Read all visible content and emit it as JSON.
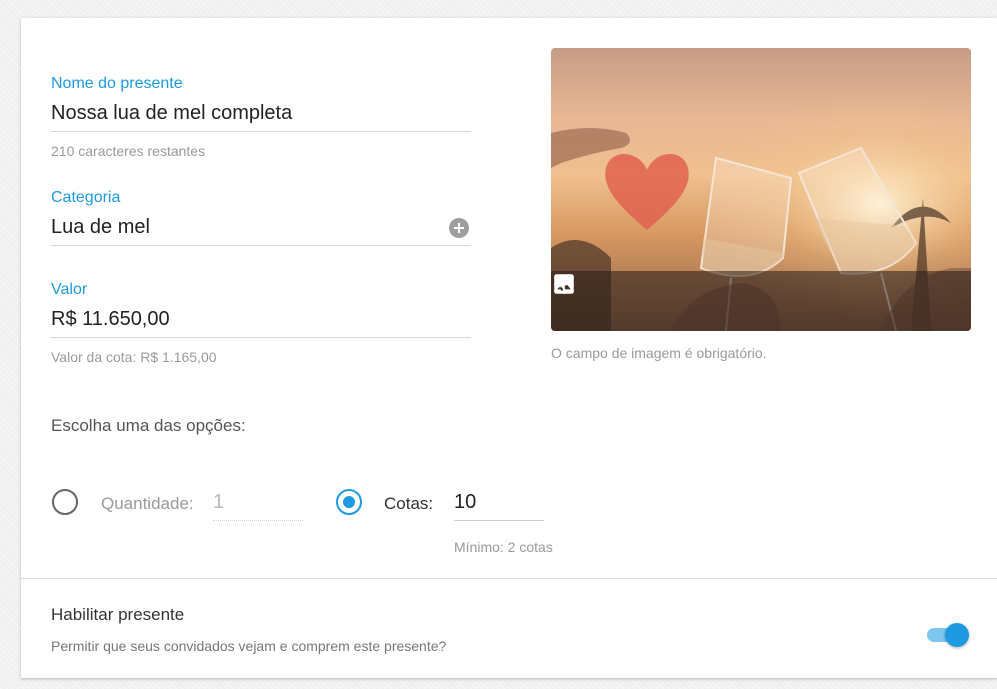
{
  "form": {
    "name_label": "Nome do presente",
    "name_value": "Nossa lua de mel completa",
    "name_help": "210 caracteres restantes",
    "category_label": "Categoria",
    "category_value": "Lua de mel",
    "value_label": "Valor",
    "value_value": "R$ 11.650,00",
    "value_help": "Valor da cota: R$ 1.165,00"
  },
  "image": {
    "help": "O campo de imagem é obrigatório.",
    "icons": [
      "tune-icon",
      "image-icon"
    ]
  },
  "options": {
    "title": "Escolha uma das opções:",
    "quantity_label": "Quantidade:",
    "quantity_value": "1",
    "quantity_checked": false,
    "shares_label": "Cotas:",
    "shares_value": "10",
    "shares_checked": true,
    "shares_help": "Mínimo: 2 cotas"
  },
  "enable": {
    "title": "Habilitar presente",
    "help": "Permitir que seus convidados vejam e comprem este presente?",
    "on": true
  },
  "colors": {
    "accent": "#1e9ae0",
    "toggle_track": "#7cc6f0",
    "muted_text": "#9a9a9a"
  }
}
